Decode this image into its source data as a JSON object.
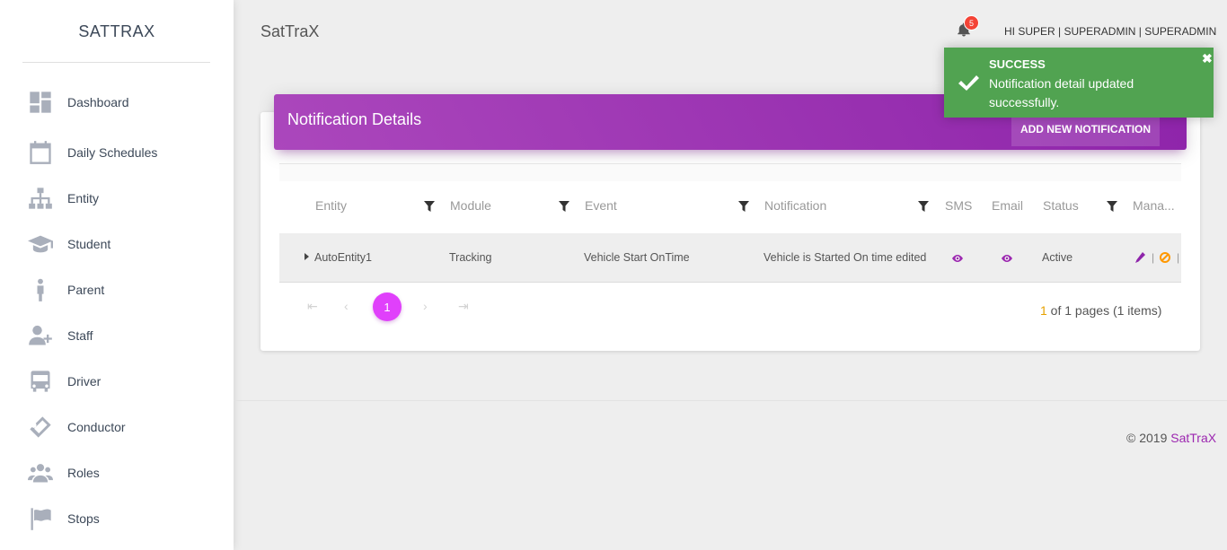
{
  "sidebar": {
    "brand": "SATTRAX",
    "items": [
      {
        "label": "Dashboard",
        "icon": "dashboard-icon"
      },
      {
        "label": "Daily Schedules",
        "icon": "calendar-icon"
      },
      {
        "label": "Entity",
        "icon": "sitemap-icon"
      },
      {
        "label": "Student",
        "icon": "graduation-cap-icon"
      },
      {
        "label": "Parent",
        "icon": "person-icon"
      },
      {
        "label": "Staff",
        "icon": "user-plus-icon"
      },
      {
        "label": "Driver",
        "icon": "bus-icon"
      },
      {
        "label": "Conductor",
        "icon": "ticket-icon"
      },
      {
        "label": "Roles",
        "icon": "users-icon"
      },
      {
        "label": "Stops",
        "icon": "flag-icon"
      }
    ]
  },
  "header": {
    "title": "SatTraX",
    "notification_count": "5",
    "user": "HI SUPER | SUPERADMIN | SUPERADMIN"
  },
  "card": {
    "title": "Notification Details",
    "add_button": "ADD NEW NOTIFICATION"
  },
  "grid": {
    "columns": [
      "Entity",
      "Module",
      "Event",
      "Notification",
      "SMS",
      "Email",
      "Status",
      "Mana..."
    ],
    "rows": [
      {
        "entity": "AutoEntity1",
        "module": "Tracking",
        "event": "Vehicle Start OnTime",
        "notification": "Vehicle is Started On time edited",
        "status": "Active"
      }
    ],
    "separator": "|"
  },
  "pager": {
    "current_page": "1",
    "info_current": "1",
    "info_rest": " of 1 pages (1 items)"
  },
  "footer": {
    "copyright_prefix": "© 2019 ",
    "copyright_link": "SatTraX"
  },
  "toast": {
    "title": "SUCCESS",
    "message": "Notification detail updated successfully.",
    "close": "✖"
  },
  "colors": {
    "accent": "#9c27b0",
    "page_active": "#e040fb",
    "toast_success": "#51a351",
    "badge": "#f44336"
  }
}
